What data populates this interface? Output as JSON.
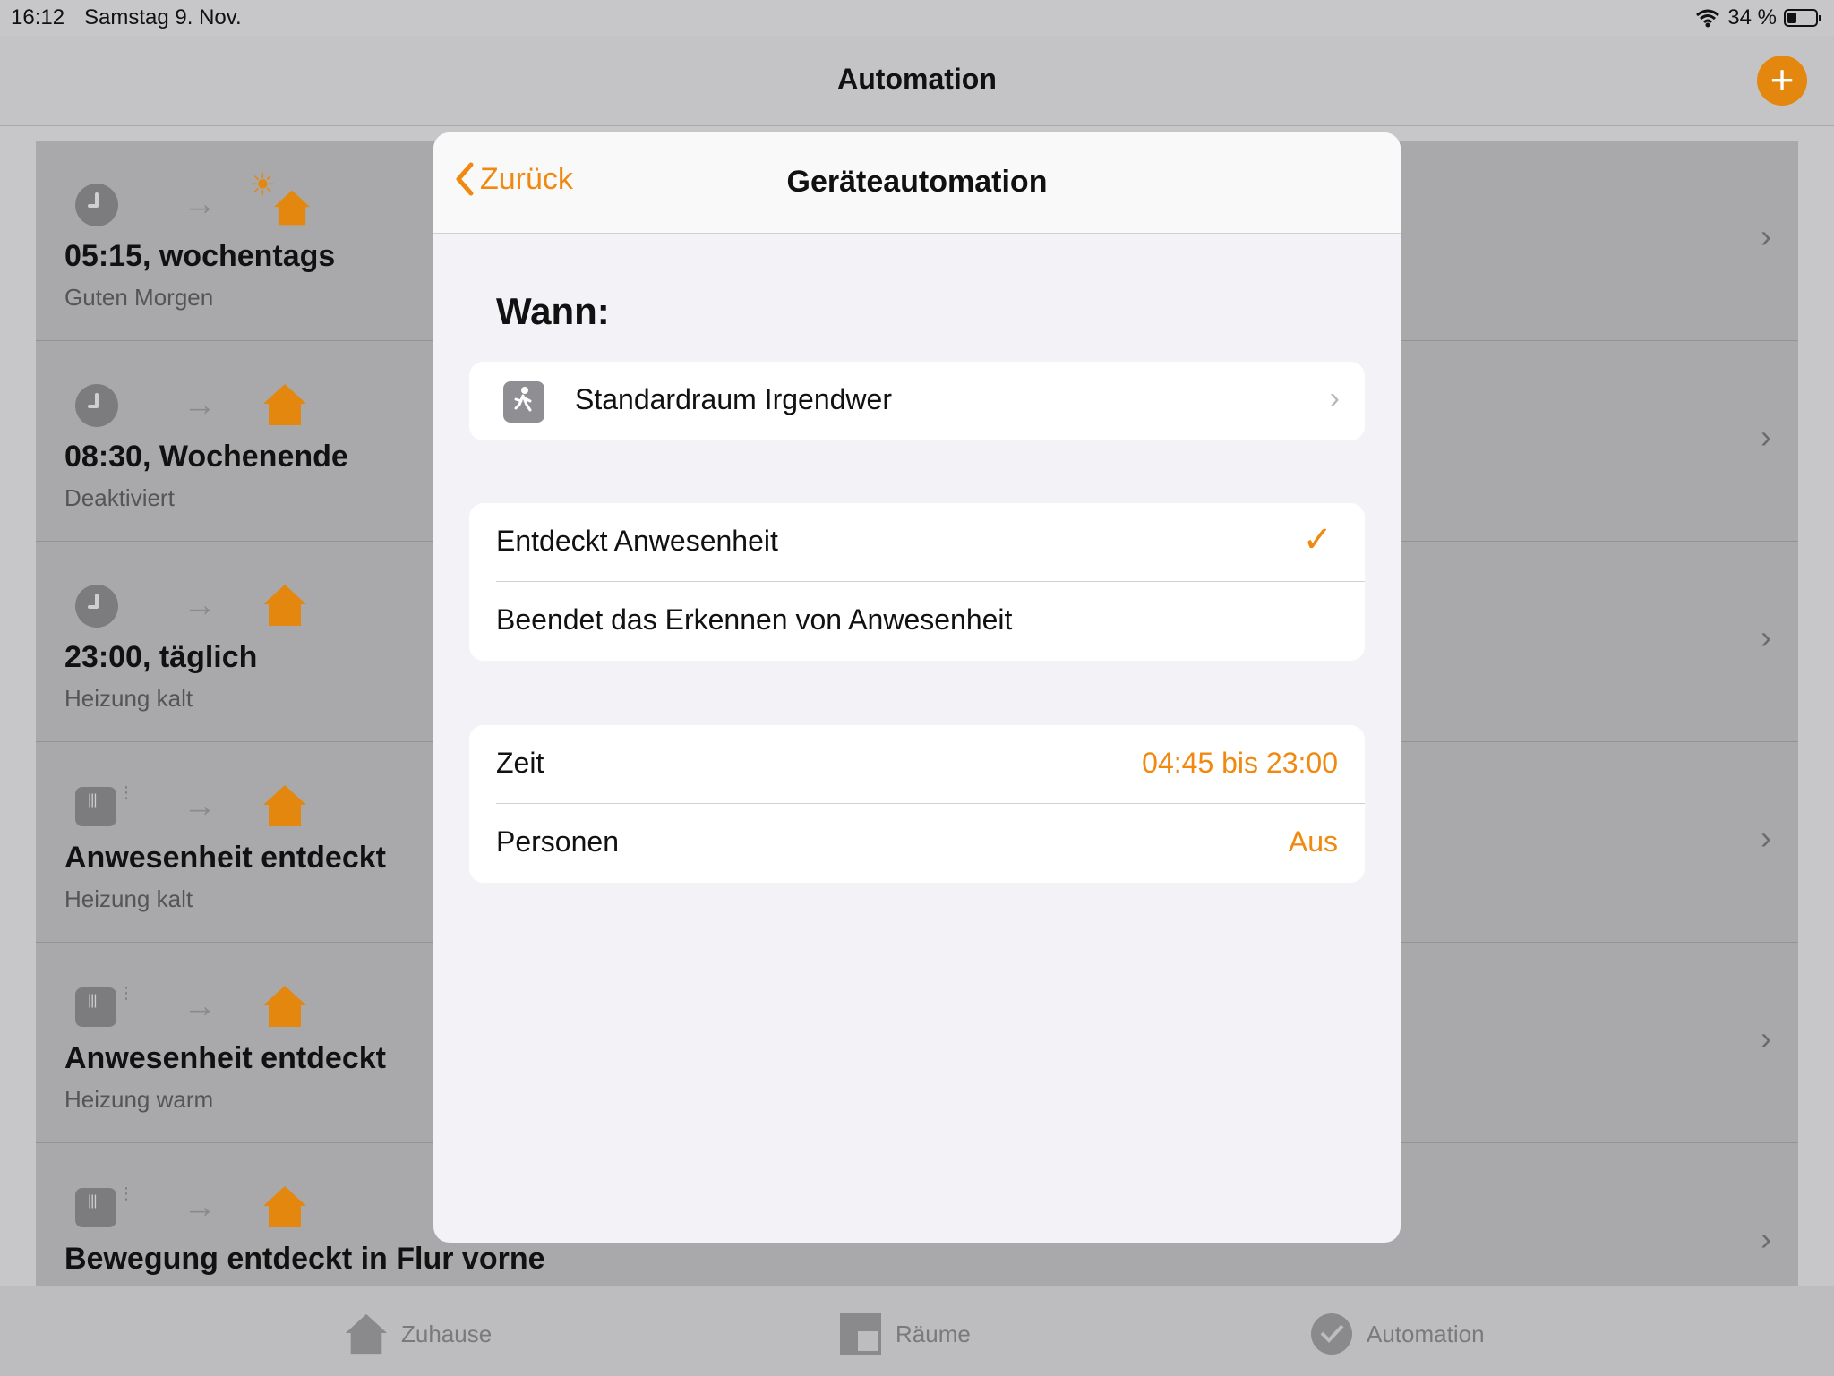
{
  "status_bar": {
    "time": "16:12",
    "date": "Samstag 9. Nov.",
    "battery": "34 %",
    "battery_level": 0.34
  },
  "nav": {
    "title": "Automation"
  },
  "automations": [
    {
      "title": "05:15, wochentags",
      "subtitle": "Guten Morgen",
      "trigger_icon": "clock-icon",
      "target_icon": "sun-house-icon"
    },
    {
      "title": "08:30, Wochenende",
      "subtitle": "Deaktiviert",
      "trigger_icon": "clock-icon",
      "target_icon": "house-icon"
    },
    {
      "title": "23:00, täglich",
      "subtitle": "Heizung kalt",
      "trigger_icon": "clock-icon",
      "target_icon": "house-icon"
    },
    {
      "title": "Anwesenheit entdeckt",
      "subtitle": "Heizung kalt",
      "trigger_icon": "sensor-icon",
      "target_icon": "house-icon"
    },
    {
      "title": "Anwesenheit entdeckt",
      "subtitle": "Heizung warm",
      "trigger_icon": "sensor-icon",
      "target_icon": "house-icon"
    },
    {
      "title": "Bewegung entdeckt in Flur vorne",
      "subtitle": "",
      "trigger_icon": "sensor-icon",
      "target_icon": "house-icon"
    }
  ],
  "tabs": [
    {
      "label": "Zuhause",
      "icon": "house-icon"
    },
    {
      "label": "Räume",
      "icon": "rooms-icon"
    },
    {
      "label": "Automation",
      "icon": "automation-check-icon"
    }
  ],
  "modal": {
    "back_label": "Zurück",
    "title": "Geräteautomation",
    "section_heading": "Wann:",
    "sensor_row": {
      "label": "Standardraum Irgendwer",
      "icon": "person-walking-icon"
    },
    "options": [
      {
        "label": "Entdeckt Anwesenheit",
        "selected": true
      },
      {
        "label": "Beendet das Erkennen von Anwesenheit",
        "selected": false
      }
    ],
    "settings": [
      {
        "label": "Zeit",
        "value": "04:45 bis 23:00"
      },
      {
        "label": "Personen",
        "value": "Aus"
      }
    ]
  },
  "colors": {
    "accent": "#f0890f",
    "dim_accent": "#e3870f",
    "background": "#c7c7c9",
    "modal_background": "#f2f2f7"
  }
}
